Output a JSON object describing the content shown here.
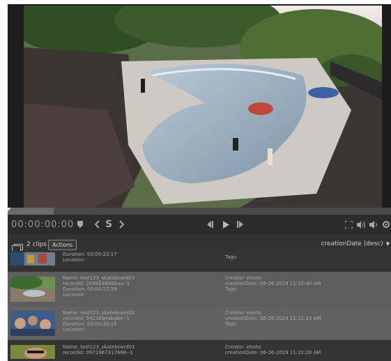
{
  "player": {
    "timecode": "00:00:00:00",
    "progress_fraction": 0.12,
    "icons": {
      "marker": "marker-icon",
      "mark_in": "mark-in-icon",
      "split": "S",
      "mark_out": "mark-out-icon",
      "prev_frame": "previous-frame-icon",
      "play": "play-icon",
      "next_frame": "next-frame-icon",
      "fullscreen": "fullscreen-icon",
      "volume": "volume-icon",
      "audio_out": "speaker-icon",
      "settings": "gear-icon"
    }
  },
  "list": {
    "count_label": "2 clips",
    "actions_label": "Actions",
    "sort_value": "creationDate (desc)"
  },
  "rows": [
    {
      "lines_left": [
        "Duration: 00:00:23:17",
        "Location:"
      ],
      "lines_right": [
        "Tags:"
      ]
    },
    {
      "lines_left": [
        "Name: test123_skateboard03",
        "recordId: 2699248866aa--1",
        "Duration: 00:00:27:29",
        "Location:"
      ],
      "lines_right": [
        "Creator: elesto",
        "creationDate: 06-26-2019 11:22:40 AM",
        "Tags:"
      ]
    },
    {
      "lines_left": [
        "Name: test123_skateboard02",
        "recordId: 5423d8eaba64--1",
        "Duration: 00:00:20:16",
        "Location:"
      ],
      "lines_right": [
        "Creator: elesto",
        "creationDate: 06-26-2019 11:22:33 AM",
        "Tags:"
      ]
    },
    {
      "lines_left": [
        "Name: test123_skateboard01",
        "recordId: 0971967317668--1"
      ],
      "lines_right": [
        "Creator: elesto",
        "creationDate: 06-26-2019 11:22:28 AM"
      ]
    }
  ],
  "colors": {
    "app_bg": "#323232",
    "row_selected": "#5d5d5d",
    "text_muted": "#a9a9a9"
  }
}
